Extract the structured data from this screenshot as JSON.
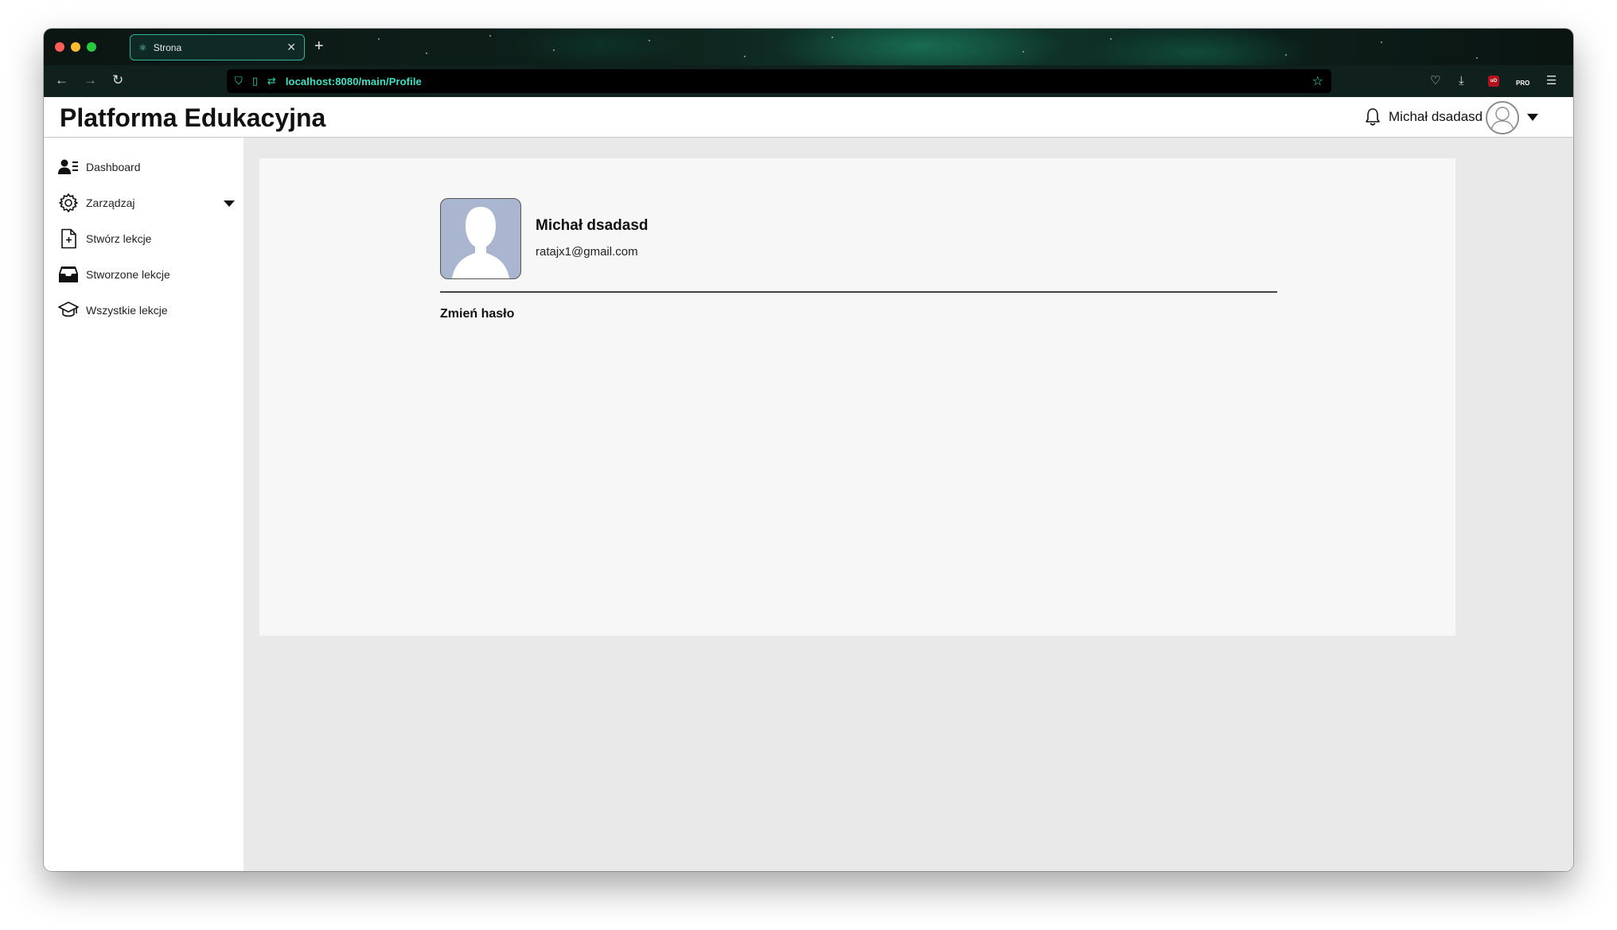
{
  "browser": {
    "tab_title": "Strona",
    "url": "localhost:8080/main/Profile",
    "icons": {
      "tab": "react-icon",
      "close": "close-icon",
      "new_tab": "plus-icon",
      "back": "arrow-left-icon",
      "forward": "arrow-right-icon",
      "reload": "reload-icon",
      "shield": "shield-icon",
      "page": "page-icon",
      "permissions": "permissions-icon",
      "bookmark": "star-icon",
      "pocket": "pocket-icon",
      "download": "download-icon",
      "ublock": "ublock-icon",
      "extension": "pro-extension-icon",
      "menu": "hamburger-menu-icon"
    },
    "ublock_label": "uO",
    "extension_label": "PRO"
  },
  "header": {
    "title": "Platforma Edukacyjna",
    "user_name": "Michał dsadasd"
  },
  "sidebar": {
    "items": [
      {
        "label": "Dashboard",
        "icon": "user-list-icon"
      },
      {
        "label": "Zarządzaj",
        "icon": "gear-icon"
      },
      {
        "label": "Stwórz lekcje",
        "icon": "file-plus-icon"
      },
      {
        "label": "Stworzone lekcje",
        "icon": "inbox-icon"
      },
      {
        "label": "Wszystkie lekcje",
        "icon": "graduation-cap-icon"
      }
    ]
  },
  "profile": {
    "name": "Michał dsadasd",
    "email": "ratajx1@gmail.com",
    "change_password": "Zmień hasło"
  }
}
